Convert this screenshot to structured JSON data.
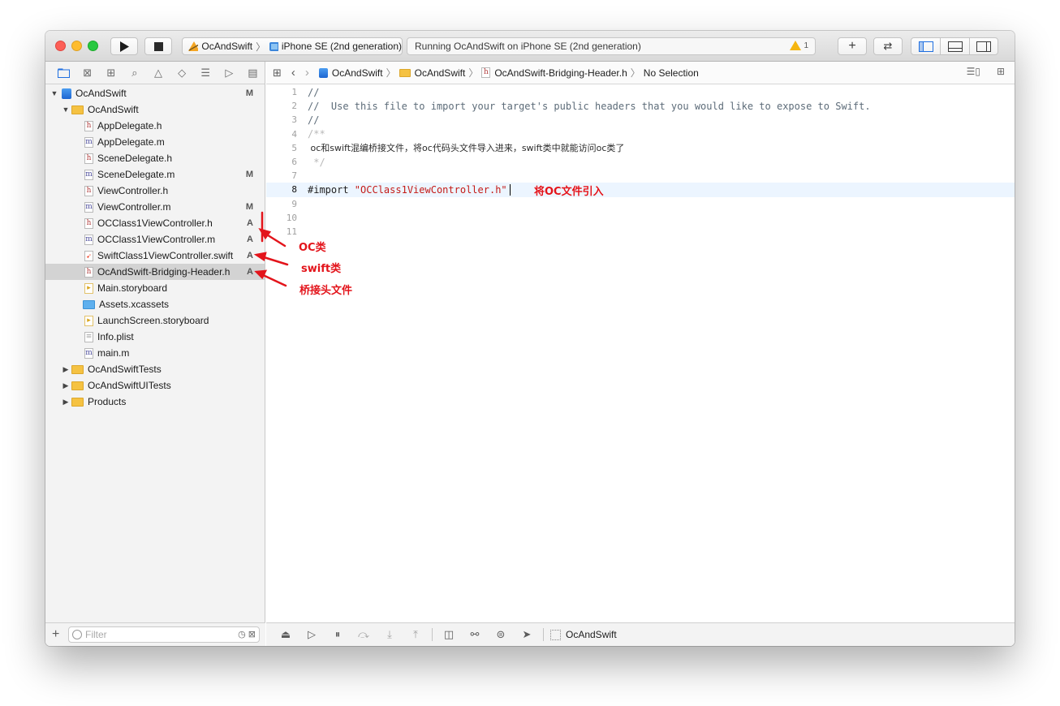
{
  "toolbar": {
    "run_icon": "play-icon",
    "stop_icon": "stop-icon",
    "scheme_name": "OcAndSwift",
    "scheme_sep": "〉",
    "device_name": "iPhone SE (2nd generation)",
    "activity_status": "Running OcAndSwift on iPhone SE (2nd generation)",
    "warning_count": "1",
    "library_label": "+",
    "review_label": "⇄",
    "colors": {
      "warning": "#f5b50f",
      "accent": "#1f6fe0",
      "close": "#fd5f57",
      "minimize": "#febc2e",
      "zoom": "#28c840"
    }
  },
  "navigator": {
    "tab_icons": [
      "folder-icon",
      "source-control-icon",
      "symbol-icon",
      "find-icon",
      "issue-icon",
      "test-icon",
      "debug-icon",
      "breakpoint-icon",
      "report-icon"
    ],
    "tree": [
      {
        "label": "OcAndSwift",
        "status": "M",
        "icon": "project-icon",
        "depth": 0,
        "expanded": true
      },
      {
        "label": "OcAndSwift",
        "status": "",
        "icon": "folder-icon",
        "depth": 1,
        "expanded": true
      },
      {
        "label": "AppDelegate.h",
        "status": "",
        "icon": "h",
        "depth": 2
      },
      {
        "label": "AppDelegate.m",
        "status": "",
        "icon": "m",
        "depth": 2
      },
      {
        "label": "SceneDelegate.h",
        "status": "",
        "icon": "h",
        "depth": 2
      },
      {
        "label": "SceneDelegate.m",
        "status": "M",
        "icon": "m",
        "depth": 2
      },
      {
        "label": "ViewController.h",
        "status": "",
        "icon": "h",
        "depth": 2
      },
      {
        "label": "ViewController.m",
        "status": "M",
        "icon": "m",
        "depth": 2
      },
      {
        "label": "OCClass1ViewController.h",
        "status": "A",
        "icon": "h",
        "depth": 2
      },
      {
        "label": "OCClass1ViewController.m",
        "status": "A",
        "icon": "m",
        "depth": 2
      },
      {
        "label": "SwiftClass1ViewController.swift",
        "status": "A",
        "icon": "swift",
        "depth": 2
      },
      {
        "label": "OcAndSwift-Bridging-Header.h",
        "status": "A",
        "icon": "h",
        "depth": 2,
        "selected": true
      },
      {
        "label": "Main.storyboard",
        "status": "",
        "icon": "sb",
        "depth": 2
      },
      {
        "label": "Assets.xcassets",
        "status": "",
        "icon": "assets",
        "depth": 2
      },
      {
        "label": "LaunchScreen.storyboard",
        "status": "",
        "icon": "sb",
        "depth": 2
      },
      {
        "label": "Info.plist",
        "status": "",
        "icon": "plist",
        "depth": 2
      },
      {
        "label": "main.m",
        "status": "",
        "icon": "m",
        "depth": 2
      },
      {
        "label": "OcAndSwiftTests",
        "status": "",
        "icon": "folder-icon",
        "depth": 1,
        "expanded": false
      },
      {
        "label": "OcAndSwiftUITests",
        "status": "",
        "icon": "folder-icon",
        "depth": 1,
        "expanded": false
      },
      {
        "label": "Products",
        "status": "",
        "icon": "folder-icon",
        "depth": 1,
        "expanded": false
      }
    ],
    "filter_placeholder": "Filter",
    "add_label": "+"
  },
  "jumpbar": {
    "crumbs": [
      "OcAndSwift",
      "OcAndSwift",
      "OcAndSwift-Bridging-Header.h",
      "No Selection"
    ],
    "sep": "〉"
  },
  "code": {
    "lines": [
      {
        "n": "1",
        "text": "//",
        "kind": "comment"
      },
      {
        "n": "2",
        "text": "//  Use this file to import your target's public headers that you would like to expose to Swift.",
        "kind": "comment"
      },
      {
        "n": "3",
        "text": "//",
        "kind": "comment"
      },
      {
        "n": "4",
        "text": "/**",
        "kind": "dim"
      },
      {
        "n": "5",
        "text": " oc和swift混编桥接文件，将oc代码头文件导入进来，swift类中就能访问oc类了",
        "kind": "cjk"
      },
      {
        "n": "6",
        "text": " */",
        "kind": "dim"
      },
      {
        "n": "7",
        "text": "",
        "kind": "plain"
      },
      {
        "n": "8",
        "text": "",
        "kind": "import",
        "current": true
      },
      {
        "n": "9",
        "text": "",
        "kind": "plain"
      },
      {
        "n": "10",
        "text": "",
        "kind": "plain"
      },
      {
        "n": "11",
        "text": "",
        "kind": "plain"
      }
    ],
    "import_keyword": "#import ",
    "import_path": "\"OCClass1ViewController.h\""
  },
  "debugbar": {
    "target": "OcAndSwift"
  },
  "annotations": {
    "import_note": "将OC文件引入",
    "oc_class": "OC类",
    "swift_class": "swift类",
    "bridging_header": "桥接头文件",
    "color": "#e3141b"
  }
}
